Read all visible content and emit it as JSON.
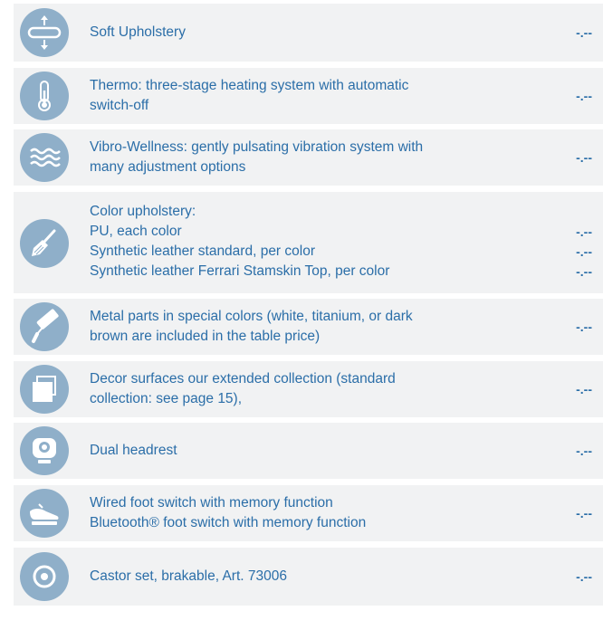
{
  "colors": {
    "text": "#2b6ea8",
    "icon_bg": "#8fafc9",
    "row_bg": "#f1f2f3"
  },
  "items": [
    {
      "icon": "upholstery-icon",
      "lines": [
        "Soft Upholstery"
      ],
      "prices": [
        "-.--"
      ]
    },
    {
      "icon": "thermometer-icon",
      "lines": [
        "Thermo: three-stage heating system with automatic",
        "switch-off"
      ],
      "prices": [
        "-.--"
      ]
    },
    {
      "icon": "vibration-waves-icon",
      "lines": [
        "Vibro-Wellness: gently pulsating vibration system with",
        "many adjustment options"
      ],
      "prices": [
        "-.--"
      ]
    },
    {
      "icon": "paint-brush-icon",
      "lines": [
        "Color upholstery:",
        "PU, each color",
        "Synthetic leather standard, per color",
        "Synthetic leather Ferrari Stamskin Top, per color"
      ],
      "prices": [
        "-.--",
        "-.--",
        "-.--"
      ]
    },
    {
      "icon": "paint-roller-icon",
      "lines": [
        "Metal parts in special colors (white, titanium, or dark",
        "brown are included in the table price)"
      ],
      "prices": [
        "-.--"
      ]
    },
    {
      "icon": "decor-surface-icon",
      "lines": [
        "Decor surfaces  our extended collection (standard",
        "collection: see page 15),"
      ],
      "prices": [
        "-.--"
      ]
    },
    {
      "icon": "headrest-icon",
      "lines": [
        "Dual headrest"
      ],
      "prices": [
        "-.--"
      ]
    },
    {
      "icon": "foot-switch-icon",
      "lines": [
        "Wired foot switch with memory function",
        "Bluetooth® foot switch with memory function"
      ],
      "prices": [
        "-.--"
      ]
    },
    {
      "icon": "castor-icon",
      "lines": [
        "Castor set, brakable, Art. 73006"
      ],
      "prices": [
        "-.--"
      ]
    }
  ]
}
